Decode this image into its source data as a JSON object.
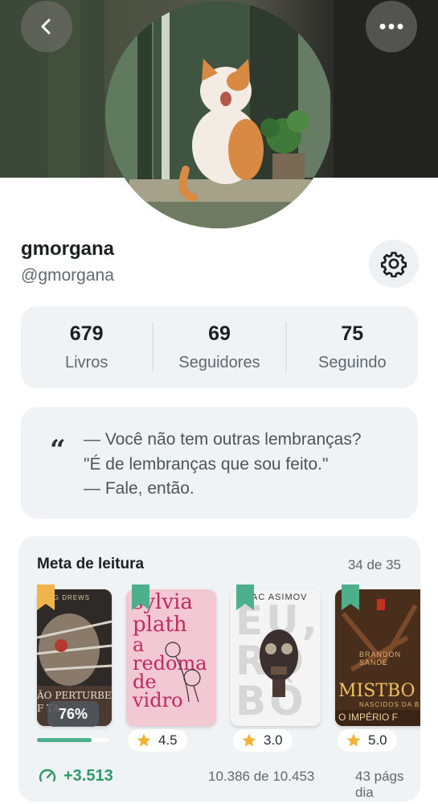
{
  "profile": {
    "display_name": "gmorgana",
    "handle": "@gmorgana"
  },
  "header": {
    "back_icon": "chevron-left-icon",
    "more_icon": "more-horizontal-icon",
    "settings_icon": "gear-icon"
  },
  "stats": [
    {
      "value": "679",
      "label": "Livros"
    },
    {
      "value": "69",
      "label": "Seguidores"
    },
    {
      "value": "75",
      "label": "Seguindo"
    }
  ],
  "quote": {
    "mark": "“",
    "lines": [
      "— Você não tem outras lembranças?",
      "\"É de lembranças que sou feito.\"",
      "— Fale, então."
    ]
  },
  "reading_goal": {
    "title": "Meta de leitura",
    "count": "34 de 35",
    "books": [
      {
        "cover_author": "CG DREWS",
        "cover_title_lines": [
          "ÃO PERTURBE",
          "F   TA"
        ],
        "progress_label": "76%",
        "progress": 0.76,
        "bookmark_color": "#f0b44a"
      },
      {
        "cover_author": "sylvia plath",
        "cover_title_lines": [
          "a",
          "redoma",
          "de",
          "vidro"
        ],
        "rating": "4.5",
        "bookmark_color": "#4cb08d"
      },
      {
        "cover_author": "AC ASIMOV",
        "cover_title_lines": [
          "EU,",
          "RO",
          "BÔ"
        ],
        "rating": "3.0",
        "bookmark_color": "#4cb08d"
      },
      {
        "cover_author": "BRANDON SANDE",
        "cover_title_lines": [
          "MISTBO",
          "NASCIDOS DA B",
          "O IMPÉRIO F"
        ],
        "rating": "5.0",
        "bookmark_color": "#4cb08d"
      }
    ],
    "footer": {
      "gain": "+3.513",
      "pages": "10.386 de 10.453",
      "daily": "43 págs dia"
    }
  },
  "colors": {
    "accent_green": "#4cb08d",
    "gain_green": "#2f9a66",
    "star": "#f2b233",
    "card_bg": "#f0f3f5"
  }
}
